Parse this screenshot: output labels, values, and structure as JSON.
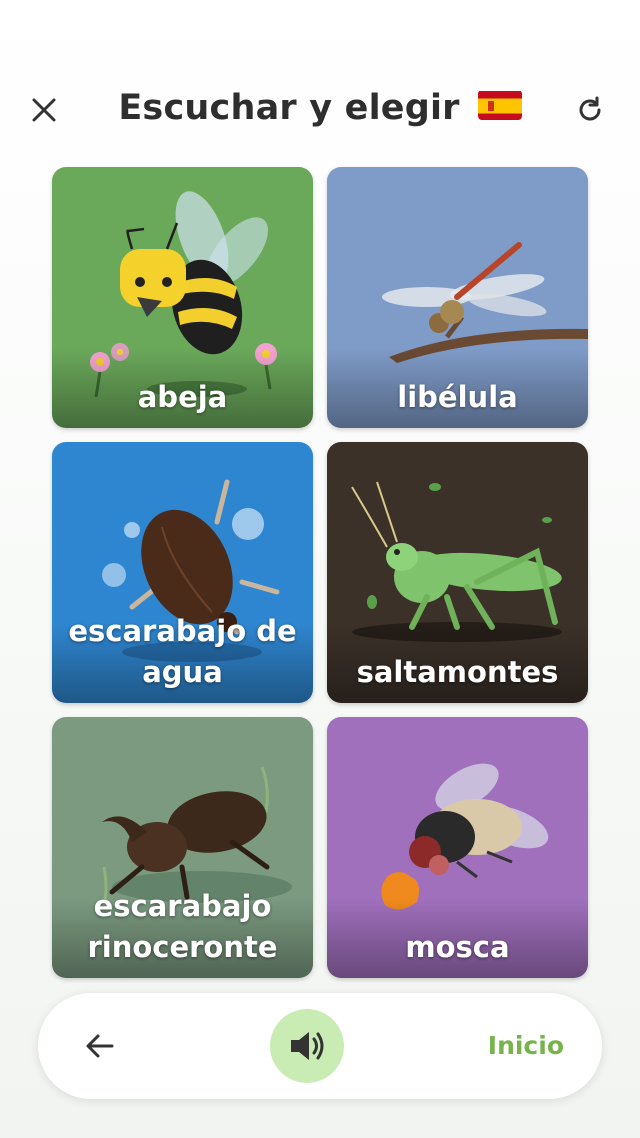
{
  "header": {
    "title": "Escuchar y elegir",
    "flag": "spain-flag-icon",
    "close_icon": "close-icon",
    "refresh_icon": "refresh-icon"
  },
  "cards": [
    {
      "label": "abeja",
      "bg": "#6aa85a",
      "image": "bee"
    },
    {
      "label": "libélula",
      "bg": "#7f9bc8",
      "image": "dragonfly"
    },
    {
      "label": "escarabajo de agua",
      "bg": "#2f86d0",
      "image": "water-beetle"
    },
    {
      "label": "saltamontes",
      "bg": "#3b3129",
      "image": "grasshopper"
    },
    {
      "label": "escarabajo rinoceronte",
      "bg": "#7b9a80",
      "image": "rhinoceros-beetle"
    },
    {
      "label": "mosca",
      "bg": "#a070bd",
      "image": "fly"
    }
  ],
  "bottom_bar": {
    "back_icon": "arrow-left-icon",
    "audio_icon": "speaker-icon",
    "home_label": "Inicio"
  },
  "colors": {
    "accent_green": "#78b34d",
    "audio_button_bg": "#c8ecb3"
  }
}
